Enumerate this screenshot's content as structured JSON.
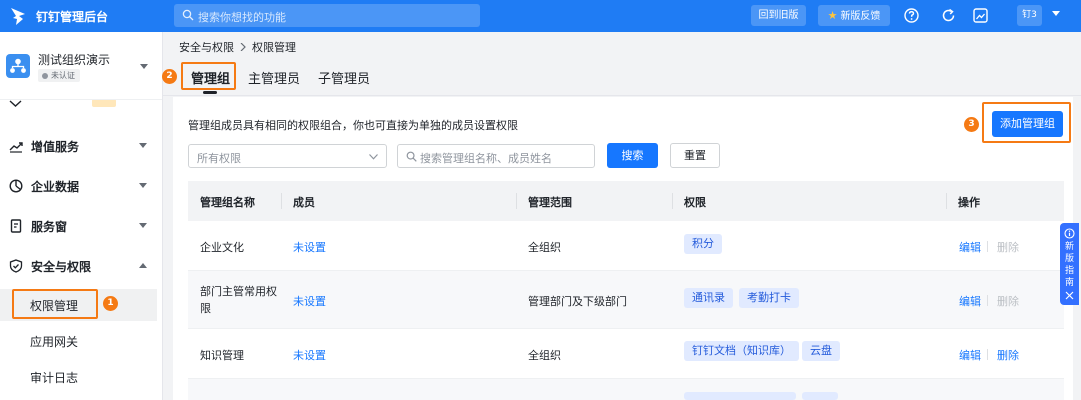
{
  "app": {
    "title": "钉钉管理后台"
  },
  "topbar": {
    "search_placeholder": "搜索你想找的功能",
    "old_version_label": "回到旧版",
    "feedback_label": "新版反馈",
    "user_label": "钉3",
    "icons": [
      "help-circle-icon",
      "refresh-icon",
      "screenshot-icon"
    ]
  },
  "org": {
    "name": "测试组织演示",
    "badge": "未认证"
  },
  "sidebar": {
    "items": [
      {
        "label": "增值服务",
        "icon": "trend-icon"
      },
      {
        "label": "企业数据",
        "icon": "chart-icon"
      },
      {
        "label": "服务窗",
        "icon": "bookmark-icon"
      },
      {
        "label": "安全与权限",
        "icon": "shield-icon"
      }
    ],
    "sub_items": [
      {
        "label": "权限管理"
      },
      {
        "label": "应用网关"
      },
      {
        "label": "审计日志"
      }
    ]
  },
  "breadcrumb": {
    "parent": "安全与权限",
    "current": "权限管理"
  },
  "tabs": [
    {
      "label": "管理组"
    },
    {
      "label": "主管理员"
    },
    {
      "label": "子管理员"
    }
  ],
  "steps": [
    "1",
    "2",
    "3"
  ],
  "content": {
    "description": "管理组成员具有相同的权限组合，你也可直接为单独的成员设置权限",
    "add_button": "添加管理组",
    "filter_placeholder": "所有权限",
    "search_placeholder": "搜索管理组名称、成员姓名",
    "search_button": "搜索",
    "reset_button": "重置"
  },
  "table": {
    "headers": [
      "管理组名称",
      "成员",
      "管理范围",
      "权限",
      "操作"
    ],
    "rows": [
      {
        "name": "企业文化",
        "members": "未设置",
        "scope": "全组织",
        "permissions": [
          "积分"
        ],
        "edit": "编辑",
        "delete": "删除"
      },
      {
        "name": "部门主管常用权限",
        "members": "未设置",
        "scope": "管理部门及下级部门",
        "permissions": [
          "通讯录",
          "考勤打卡"
        ],
        "edit": "编辑",
        "delete": "删除"
      },
      {
        "name": "知识管理",
        "members": "未设置",
        "scope": "全组织",
        "permissions": [
          "钉钉文档（知识库）",
          "云盘"
        ],
        "edit": "编辑",
        "delete": "删除"
      }
    ]
  },
  "guide": {
    "label": "新版指南"
  },
  "colors": {
    "primary": "#1677ff",
    "topbar": "#1f7cf4",
    "highlight": "#f57a14",
    "tag_bg": "#e1eaff"
  }
}
